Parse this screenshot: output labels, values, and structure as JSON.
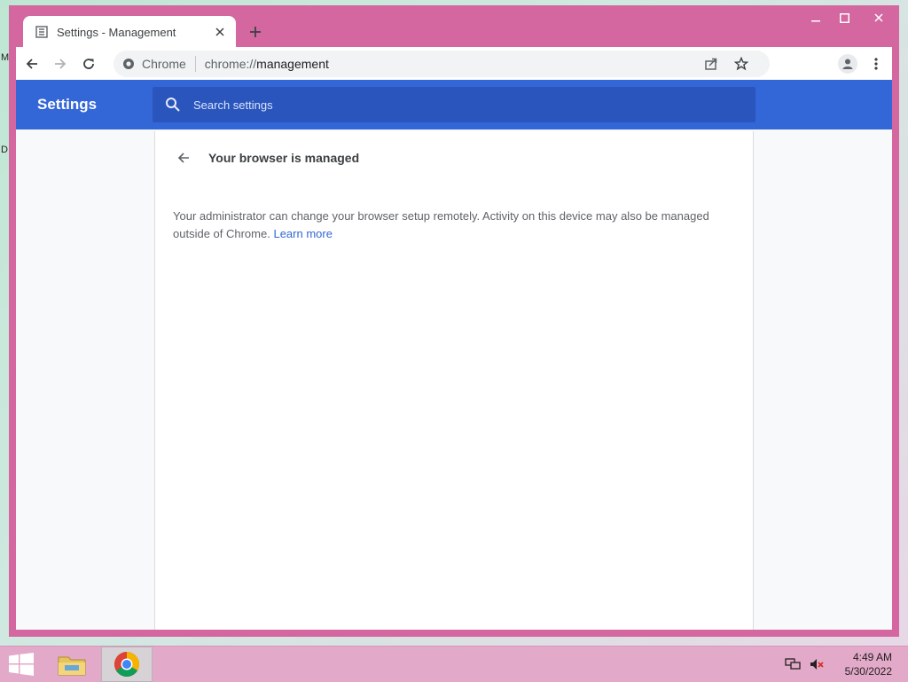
{
  "window": {
    "controls": {
      "minimize": "–",
      "maximize": "□",
      "close": "✕"
    }
  },
  "tab": {
    "title": "Settings - Management",
    "favicon": "settings-document-icon",
    "close_glyph": "✕"
  },
  "newtab_glyph": "+",
  "toolbar": {
    "site_chip": "Chrome",
    "url_scheme": "chrome://",
    "url_host": "management",
    "icons": [
      "back-icon",
      "forward-icon",
      "reload-icon",
      "share-icon",
      "star-icon",
      "profile-icon",
      "menu-icon"
    ]
  },
  "settings": {
    "title": "Settings",
    "search_placeholder": "Search settings"
  },
  "page": {
    "title": "Your browser is managed",
    "body": "Your administrator can change your browser setup remotely. Activity on this device may also be managed outside of Chrome.",
    "learn_more": "Learn more"
  },
  "taskbar": {
    "apps": [
      "file-explorer",
      "chrome"
    ],
    "active_app": "chrome",
    "time": "4:49 AM",
    "date": "5/30/2022"
  },
  "desktop": {
    "edge_letters": [
      "M",
      "D"
    ]
  },
  "colors": {
    "window_frame": "#d4679f",
    "settings_header": "#3366d6",
    "search_box": "#2a55bd",
    "link": "#3367d6",
    "taskbar": "#e3a9c8"
  }
}
